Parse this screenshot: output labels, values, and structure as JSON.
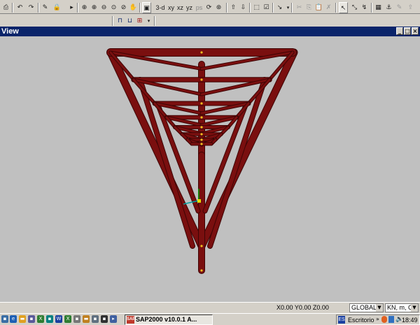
{
  "toolbar": {
    "view_3d": "3-d",
    "view_xy": "xy",
    "view_xz": "xz",
    "view_yz": "yz",
    "ps": "ps"
  },
  "window": {
    "title": "View",
    "minimize_glyph": "_",
    "maximize_glyph": "□",
    "close_glyph": "×"
  },
  "status": {
    "coordinates": "X0.00  Y0.00  Z0.00",
    "coord_system": "GLOBAL",
    "units": "KN, m, C"
  },
  "taskbar": {
    "app_label": "SAP2000 v10.0.1  A...",
    "app_icon_text": "SAP",
    "desktop_label": "Escritorio",
    "lang_indicator": "ES",
    "clock": "18:49"
  },
  "colors": {
    "member_fill": "#7a0f0f",
    "member_edge": "#3f0505",
    "viewport_bg": "#c0c0c0",
    "title_bg": "#0a246a"
  }
}
